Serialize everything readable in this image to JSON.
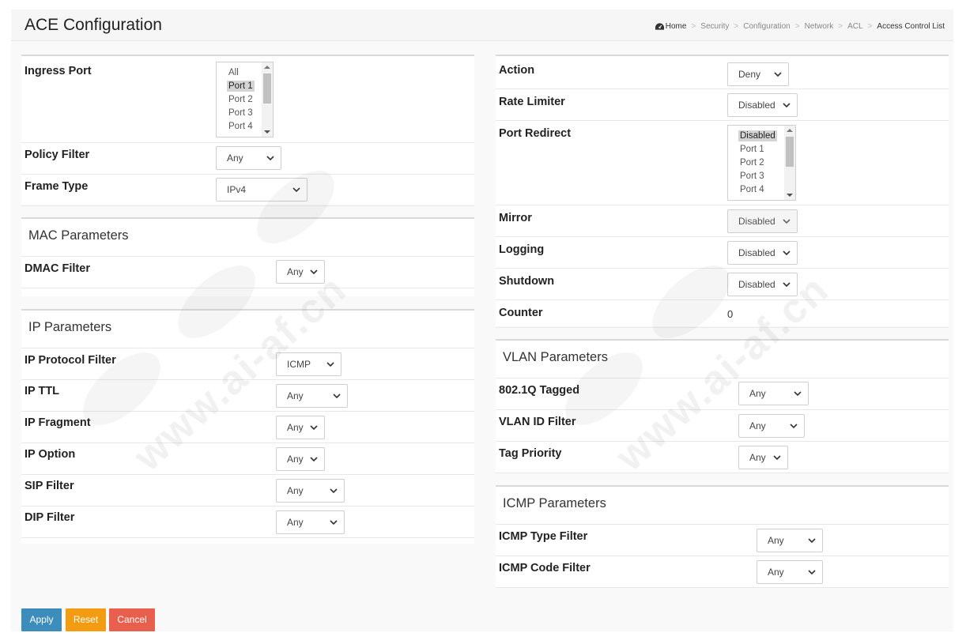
{
  "header": {
    "title": "ACE Configuration",
    "breadcrumb": [
      "Home",
      "Security",
      "Configuration",
      "Network",
      "ACL",
      "Access Control List"
    ]
  },
  "left": {
    "ingress_port": {
      "label": "Ingress Port",
      "options": [
        "All",
        "Port 1",
        "Port 2",
        "Port 3",
        "Port 4"
      ],
      "selected": "Port 1"
    },
    "policy_filter": {
      "label": "Policy Filter",
      "value": "Any"
    },
    "frame_type": {
      "label": "Frame Type",
      "value": "IPv4"
    },
    "mac": {
      "title": "MAC Parameters",
      "dmac_filter": {
        "label": "DMAC Filter",
        "value": "Any"
      }
    },
    "ip": {
      "title": "IP Parameters",
      "protocol_filter": {
        "label": "IP Protocol Filter",
        "value": "ICMP"
      },
      "ttl": {
        "label": "IP TTL",
        "value": "Any"
      },
      "fragment": {
        "label": "IP Fragment",
        "value": "Any"
      },
      "option": {
        "label": "IP Option",
        "value": "Any"
      },
      "sip_filter": {
        "label": "SIP Filter",
        "value": "Any"
      },
      "dip_filter": {
        "label": "DIP Filter",
        "value": "Any"
      }
    }
  },
  "right": {
    "action": {
      "label": "Action",
      "value": "Deny"
    },
    "rate_limiter": {
      "label": "Rate Limiter",
      "value": "Disabled"
    },
    "port_redirect": {
      "label": "Port Redirect",
      "options": [
        "Disabled",
        "Port 1",
        "Port 2",
        "Port 3",
        "Port 4"
      ],
      "selected": "Disabled"
    },
    "mirror": {
      "label": "Mirror",
      "value": "Disabled"
    },
    "logging": {
      "label": "Logging",
      "value": "Disabled"
    },
    "shutdown": {
      "label": "Shutdown",
      "value": "Disabled"
    },
    "counter": {
      "label": "Counter",
      "value": "0"
    },
    "vlan": {
      "title": "VLAN Parameters",
      "tagged": {
        "label": "802.1Q Tagged",
        "value": "Any"
      },
      "vlan_id_filter": {
        "label": "VLAN ID Filter",
        "value": "Any"
      },
      "tag_priority": {
        "label": "Tag Priority",
        "value": "Any"
      }
    },
    "icmp": {
      "title": "ICMP Parameters",
      "type_filter": {
        "label": "ICMP Type Filter",
        "value": "Any"
      },
      "code_filter": {
        "label": "ICMP Code Filter",
        "value": "Any"
      }
    }
  },
  "buttons": {
    "apply": "Apply",
    "reset": "Reset",
    "cancel": "Cancel"
  },
  "watermark": "www.ai-af.cn",
  "colors": {
    "apply": "#3c8dbc",
    "reset": "#f39c12",
    "cancel": "#e8604d"
  }
}
